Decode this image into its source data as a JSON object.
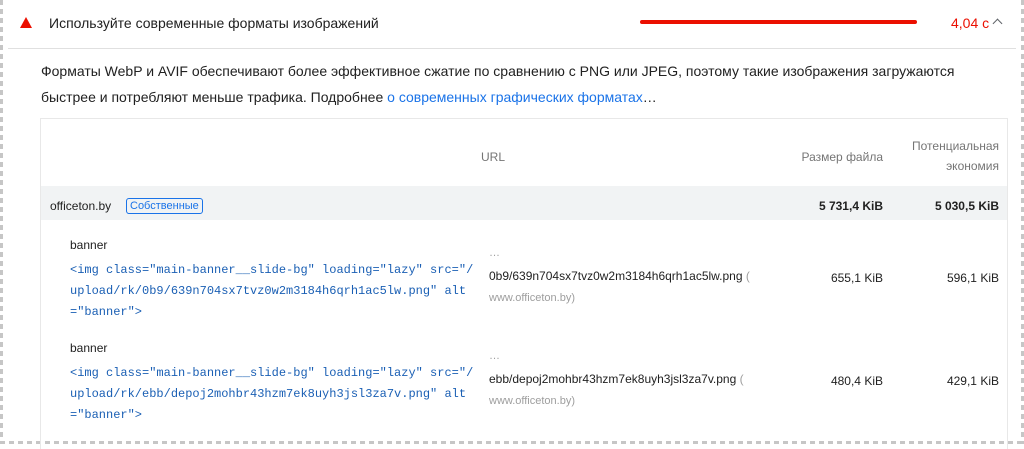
{
  "audit": {
    "title": "Используйте современные форматы изображений",
    "time": "4,04 с",
    "savings_ratio": 1.0,
    "status_color": "#eb0f00",
    "icons": {
      "status": "warning-triangle-icon",
      "toggle": "chevron-up-icon"
    }
  },
  "description": {
    "text": "Форматы WebP и AVIF обеспечивают более эффективное сжатие по сравнению с PNG или JPEG, поэтому такие изображения загружаются быстрее и потребляют меньше трафика. Подробнее ",
    "link_text": "о современных графических форматах",
    "link_suffix": "…"
  },
  "table": {
    "headers": {
      "url": "URL",
      "size": "Размер файла",
      "savings_line1": "Потенциальная",
      "savings_line2": "экономия"
    },
    "group": {
      "entity": "officeton.by",
      "badge": "Собственные",
      "size": "5 731,4 KiB",
      "savings": "5 030,5 KiB"
    },
    "rows": [
      {
        "node_label": "banner",
        "snippet": "<img class=\"main-banner__slide-bg\" loading=\"lazy\" src=\"/upload/rk/0b9/639n704sx7tvz0w2m3184h6qrh1ac5lw.png\" alt=\"banner\">",
        "url_ellipsis": "…",
        "url_path": "0b9/639n704sx7tvz0w2m3184h6qrh1ac5lw.png",
        "url_paren": "(",
        "url_host": "www.officeton.by)",
        "size": "655,1 KiB",
        "savings": "596,1 KiB"
      },
      {
        "node_label": "banner",
        "snippet": "<img class=\"main-banner__slide-bg\" loading=\"lazy\" src=\"/upload/rk/ebb/depoj2mohbr43hzm7ek8uyh3jsl3za7v.png\" alt=\"banner\">",
        "url_ellipsis": "…",
        "url_path": "ebb/depoj2mohbr43hzm7ek8uyh3jsl3za7v.png",
        "url_paren": "(",
        "url_host": "www.officeton.by)",
        "size": "480,4 KiB",
        "savings": "429,1 KiB"
      }
    ]
  }
}
